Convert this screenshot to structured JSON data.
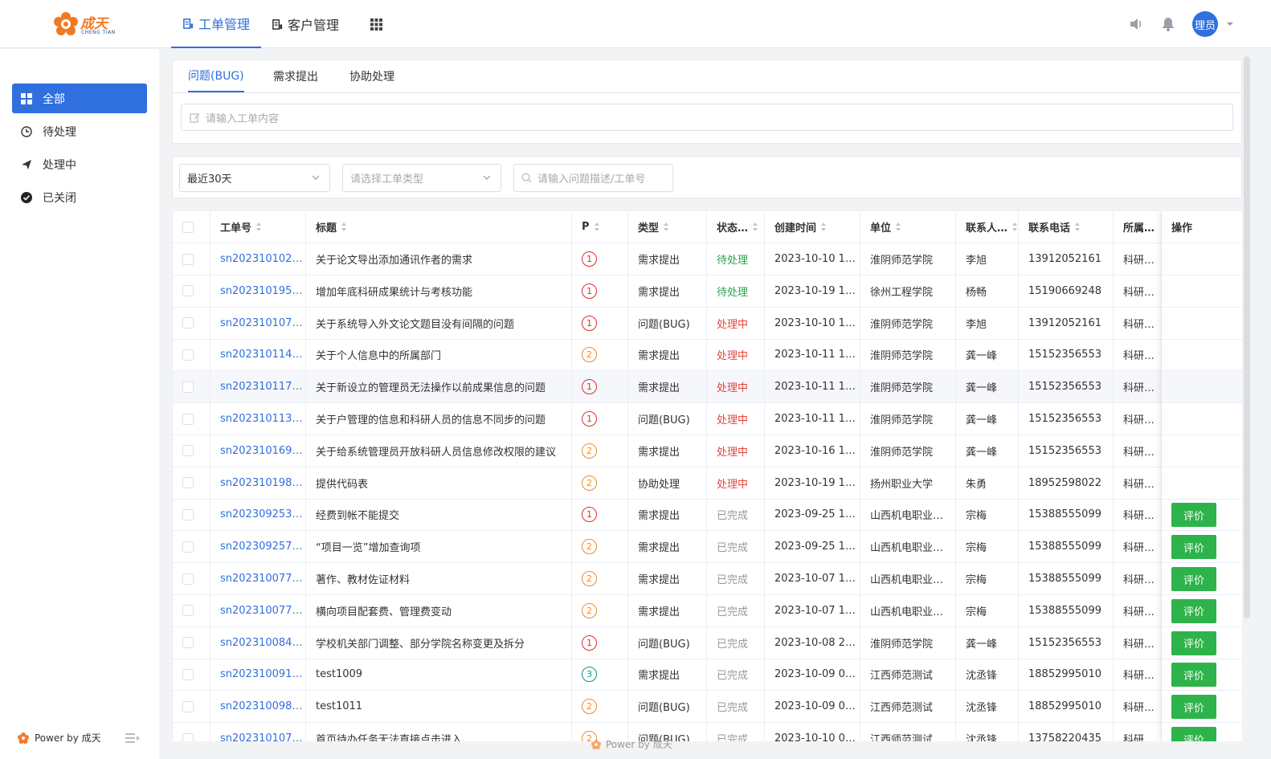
{
  "header": {
    "brand": "成天",
    "brand_sub": "CHENG TIAN",
    "nav": [
      {
        "label": "工单管理",
        "icon": "ticket-icon",
        "active": true
      },
      {
        "label": "客户管理",
        "icon": "customer-icon",
        "active": false
      }
    ],
    "apps_icon": "grid-apps-icon",
    "avatar_text": "理员"
  },
  "sidebar": {
    "items": [
      {
        "label": "全部",
        "icon": "grid-icon",
        "active": true
      },
      {
        "label": "待处理",
        "icon": "clock-icon",
        "active": false
      },
      {
        "label": "处理中",
        "icon": "send-icon",
        "active": false
      },
      {
        "label": "已关闭",
        "icon": "check-circle-icon",
        "active": false
      }
    ],
    "footer": "Power by 成天"
  },
  "create": {
    "tabs": [
      "问题(BUG)",
      "需求提出",
      "协助处理"
    ],
    "input_placeholder": "请输入工单内容"
  },
  "filters": {
    "date_range": "最近30天",
    "type_placeholder": "请选择工单类型",
    "search_placeholder": "请输入问题描述/工单号"
  },
  "table": {
    "columns": [
      "工单号",
      "标题",
      "P",
      "类型",
      "状态…",
      "创建时间",
      "单位",
      "联系人…",
      "联系电话",
      "所属产品",
      "操作"
    ],
    "rate_label": "评价",
    "rows": [
      {
        "id": "sn202310102…",
        "title": "关于论文导出添加通讯作者的需求",
        "p": "1",
        "type": "需求提出",
        "status": "待处理",
        "status_kind": "wait",
        "created": "2023-10-10 10…",
        "unit": "淮阴师范学院",
        "contact": "李旭",
        "phone": "13912052161",
        "product": "科研系统",
        "rate": false
      },
      {
        "id": "sn202310195…",
        "title": "增加年底科研成果统计与考核功能",
        "p": "1",
        "type": "需求提出",
        "status": "待处理",
        "status_kind": "wait",
        "created": "2023-10-19 11…",
        "unit": "徐州工程学院",
        "contact": "杨畅",
        "phone": "15190669248",
        "product": "科研系统",
        "rate": false
      },
      {
        "id": "sn202310107…",
        "title": "关于系统导入外文论文题目没有间隔的问题",
        "p": "1",
        "type": "问题(BUG)",
        "status": "处理中",
        "status_kind": "proc",
        "created": "2023-10-10 10…",
        "unit": "淮阴师范学院",
        "contact": "李旭",
        "phone": "13912052161",
        "product": "科研系统",
        "rate": false
      },
      {
        "id": "sn202310114…",
        "title": "关于个人信息中的所属部门",
        "p": "2",
        "type": "需求提出",
        "status": "处理中",
        "status_kind": "proc",
        "created": "2023-10-11 15…",
        "unit": "淮阴师范学院",
        "contact": "龚一峰",
        "phone": "15152356553",
        "product": "科研系统",
        "rate": false
      },
      {
        "id": "sn202310117…",
        "title": "关于新设立的管理员无法操作以前成果信息的问题",
        "p": "1",
        "type": "需求提出",
        "status": "处理中",
        "status_kind": "proc",
        "created": "2023-10-11 15…",
        "unit": "淮阴师范学院",
        "contact": "龚一峰",
        "phone": "15152356553",
        "product": "科研系统",
        "rate": false
      },
      {
        "id": "sn202310113…",
        "title": "关于户管理的信息和科研人员的信息不同步的问题",
        "p": "1",
        "type": "问题(BUG)",
        "status": "处理中",
        "status_kind": "proc",
        "created": "2023-10-11 15…",
        "unit": "淮阴师范学院",
        "contact": "龚一峰",
        "phone": "15152356553",
        "product": "科研系统",
        "rate": false
      },
      {
        "id": "sn202310169…",
        "title": "关于给系统管理员开放科研人员信息修改权限的建议",
        "p": "2",
        "type": "需求提出",
        "status": "处理中",
        "status_kind": "proc",
        "created": "2023-10-16 16…",
        "unit": "淮阴师范学院",
        "contact": "龚一峰",
        "phone": "15152356553",
        "product": "科研系统",
        "rate": false
      },
      {
        "id": "sn202310198…",
        "title": "提供代码表",
        "p": "2",
        "type": "协助处理",
        "status": "处理中",
        "status_kind": "proc",
        "created": "2023-10-19 14…",
        "unit": "扬州职业大学",
        "contact": "朱勇",
        "phone": "18952598022",
        "product": "科研系统",
        "rate": false
      },
      {
        "id": "sn202309253…",
        "title": "经费到帐不能提交",
        "p": "1",
        "type": "需求提出",
        "status": "已完成",
        "status_kind": "done",
        "created": "2023-09-25 18…",
        "unit": "山西机电职业…",
        "contact": "宗梅",
        "phone": "15388555099",
        "product": "科研系统",
        "rate": true
      },
      {
        "id": "sn202309257…",
        "title": "“项目一览”增加查询项",
        "p": "2",
        "type": "需求提出",
        "status": "已完成",
        "status_kind": "done",
        "created": "2023-09-25 19…",
        "unit": "山西机电职业…",
        "contact": "宗梅",
        "phone": "15388555099",
        "product": "科研系统",
        "rate": true
      },
      {
        "id": "sn202310077…",
        "title": "著作、教材佐证材料",
        "p": "2",
        "type": "需求提出",
        "status": "已完成",
        "status_kind": "done",
        "created": "2023-10-07 15…",
        "unit": "山西机电职业…",
        "contact": "宗梅",
        "phone": "15388555099",
        "product": "科研系统",
        "rate": true
      },
      {
        "id": "sn202310077…",
        "title": "横向项目配套费、管理费变动",
        "p": "2",
        "type": "需求提出",
        "status": "已完成",
        "status_kind": "done",
        "created": "2023-10-07 15…",
        "unit": "山西机电职业…",
        "contact": "宗梅",
        "phone": "15388555099",
        "product": "科研系统",
        "rate": true
      },
      {
        "id": "sn202310084…",
        "title": "学校机关部门调整、部分学院名称变更及拆分",
        "p": "1",
        "type": "问题(BUG)",
        "status": "已完成",
        "status_kind": "done",
        "created": "2023-10-08 20…",
        "unit": "淮阴师范学院",
        "contact": "龚一峰",
        "phone": "15152356553",
        "product": "科研系统",
        "rate": true
      },
      {
        "id": "sn202310091…",
        "title": "test1009",
        "p": "3",
        "type": "需求提出",
        "status": "已完成",
        "status_kind": "done",
        "created": "2023-10-09 09…",
        "unit": "江西师范测试",
        "contact": "沈丞锋",
        "phone": "18852995010",
        "product": "科研系统",
        "rate": true
      },
      {
        "id": "sn202310098…",
        "title": "test1011",
        "p": "2",
        "type": "问题(BUG)",
        "status": "已完成",
        "status_kind": "done",
        "created": "2023-10-09 09…",
        "unit": "江西师范测试",
        "contact": "沈丞锋",
        "phone": "18852995010",
        "product": "科研系统",
        "rate": true
      },
      {
        "id": "sn202310107…",
        "title": "首页待办任务无法直接点击进入",
        "p": "2",
        "type": "问题(BUG)",
        "status": "已完成",
        "status_kind": "done",
        "created": "2023-10-10 09…",
        "unit": "江西师范测试",
        "contact": "沈丞锋",
        "phone": "13758220435",
        "product": "科研系统",
        "rate": true
      }
    ]
  },
  "bottom_power": "Power by 成天"
}
